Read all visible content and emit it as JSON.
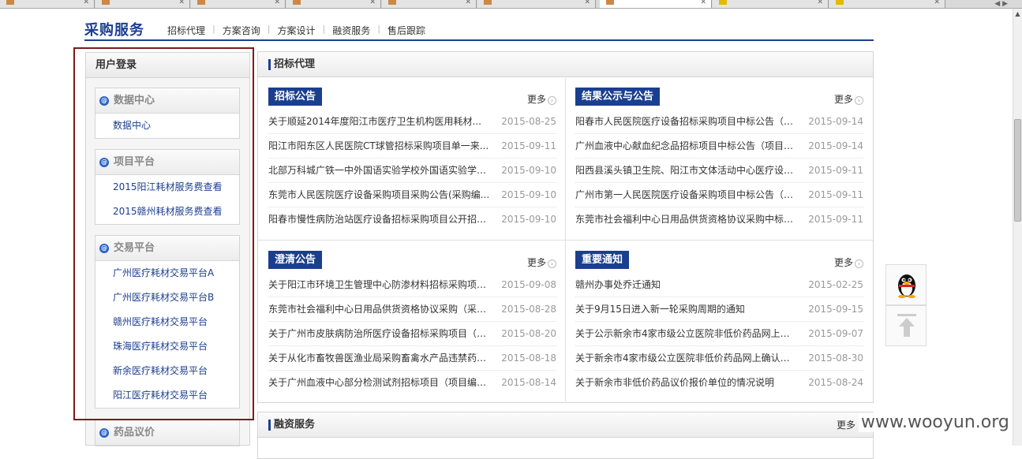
{
  "site": {
    "title": "采购服务",
    "nav": [
      "招标代理",
      "方案咨询",
      "方案设计",
      "融资服务",
      "售后跟踪"
    ]
  },
  "sidebar": {
    "login_title": "用户登录",
    "groups": [
      {
        "title": "数据中心",
        "items": [
          "数据中心"
        ]
      },
      {
        "title": "项目平台",
        "items": [
          "2015阳江耗材服务费查看",
          "2015赣州耗材服务费查看"
        ]
      },
      {
        "title": "交易平台",
        "items": [
          "广州医疗耗材交易平台A",
          "广州医疗耗材交易平台B",
          "赣州医疗耗材交易平台",
          "珠海医疗耗材交易平台",
          "新余医疗耗材交易平台",
          "阳江医疗耗材交易平台"
        ]
      },
      {
        "title": "药品议价",
        "items": []
      }
    ]
  },
  "main": {
    "panel_title": "招标代理",
    "more_label": "更多",
    "blocks": [
      {
        "title": "招标公告",
        "rows": [
          {
            "title": "关于顺延2014年度阳江市医疗卫生机构医用耗材...",
            "date": "2015-08-25"
          },
          {
            "title": "阳江市阳东区人民医院CT球管招标采购项目单一来...",
            "date": "2015-09-11"
          },
          {
            "title": "北部万科城广铁一中外国语实验学校外国语实验学校...",
            "date": "2015-09-10"
          },
          {
            "title": "东莞市人民医院医疗设备采购项目采购公告(采购编...",
            "date": "2015-09-10"
          },
          {
            "title": "阳春市慢性病防治站医疗设备招标采购项目公开招标...",
            "date": "2015-09-10"
          }
        ]
      },
      {
        "title": "结果公示与公告",
        "rows": [
          {
            "title": "阳春市人民医院医疗设备招标采购项目中标公告（招...",
            "date": "2015-09-14"
          },
          {
            "title": "广州血液中心献血纪念品招标项目中标公告（项目编...",
            "date": "2015-09-14"
          },
          {
            "title": "阳西县溪头镇卫生院、阳江市文体活动中心医疗设备...",
            "date": "2015-09-11"
          },
          {
            "title": "广州市第一人民医院医疗设备采购项目中标公告（项...",
            "date": "2015-09-11"
          },
          {
            "title": "东莞市社会福利中心日用品供货资格协议采购中标结...",
            "date": "2015-09-11"
          }
        ]
      },
      {
        "title": "澄清公告",
        "rows": [
          {
            "title": "关于阳江市环境卫生管理中心防渗材料招标采购项目...",
            "date": "2015-09-08"
          },
          {
            "title": "东莞市社会福利中心日用品供货资格协议采购（采购...",
            "date": "2015-08-28"
          },
          {
            "title": "关于广州市皮肤病防治所医疗设备招标采购项目（项...",
            "date": "2015-08-20"
          },
          {
            "title": "关于从化市畜牧兽医渔业局采购畜禽水产品违禁药物...",
            "date": "2015-08-18"
          },
          {
            "title": "关于广州血液中心部分检测试剂招标项目（项目编号...",
            "date": "2015-08-14"
          }
        ]
      },
      {
        "title": "重要通知",
        "rows": [
          {
            "title": "赣州办事处乔迁通知",
            "date": "2015-02-25"
          },
          {
            "title": "关于9月15日进入新一轮采购周期的通知",
            "date": "2015-09-15"
          },
          {
            "title": "关于公示新余市4家市级公立医院非低价药品网上议...",
            "date": "2015-09-07"
          },
          {
            "title": "关于新余市4家市级公立医院非低价药品网上确认和...",
            "date": "2015-08-30"
          },
          {
            "title": "关于新余市非低价药品议价报价单位的情况说明",
            "date": "2015-08-24"
          }
        ]
      }
    ],
    "finance_title": "融资服务"
  },
  "watermark": "www.wooyun.org"
}
